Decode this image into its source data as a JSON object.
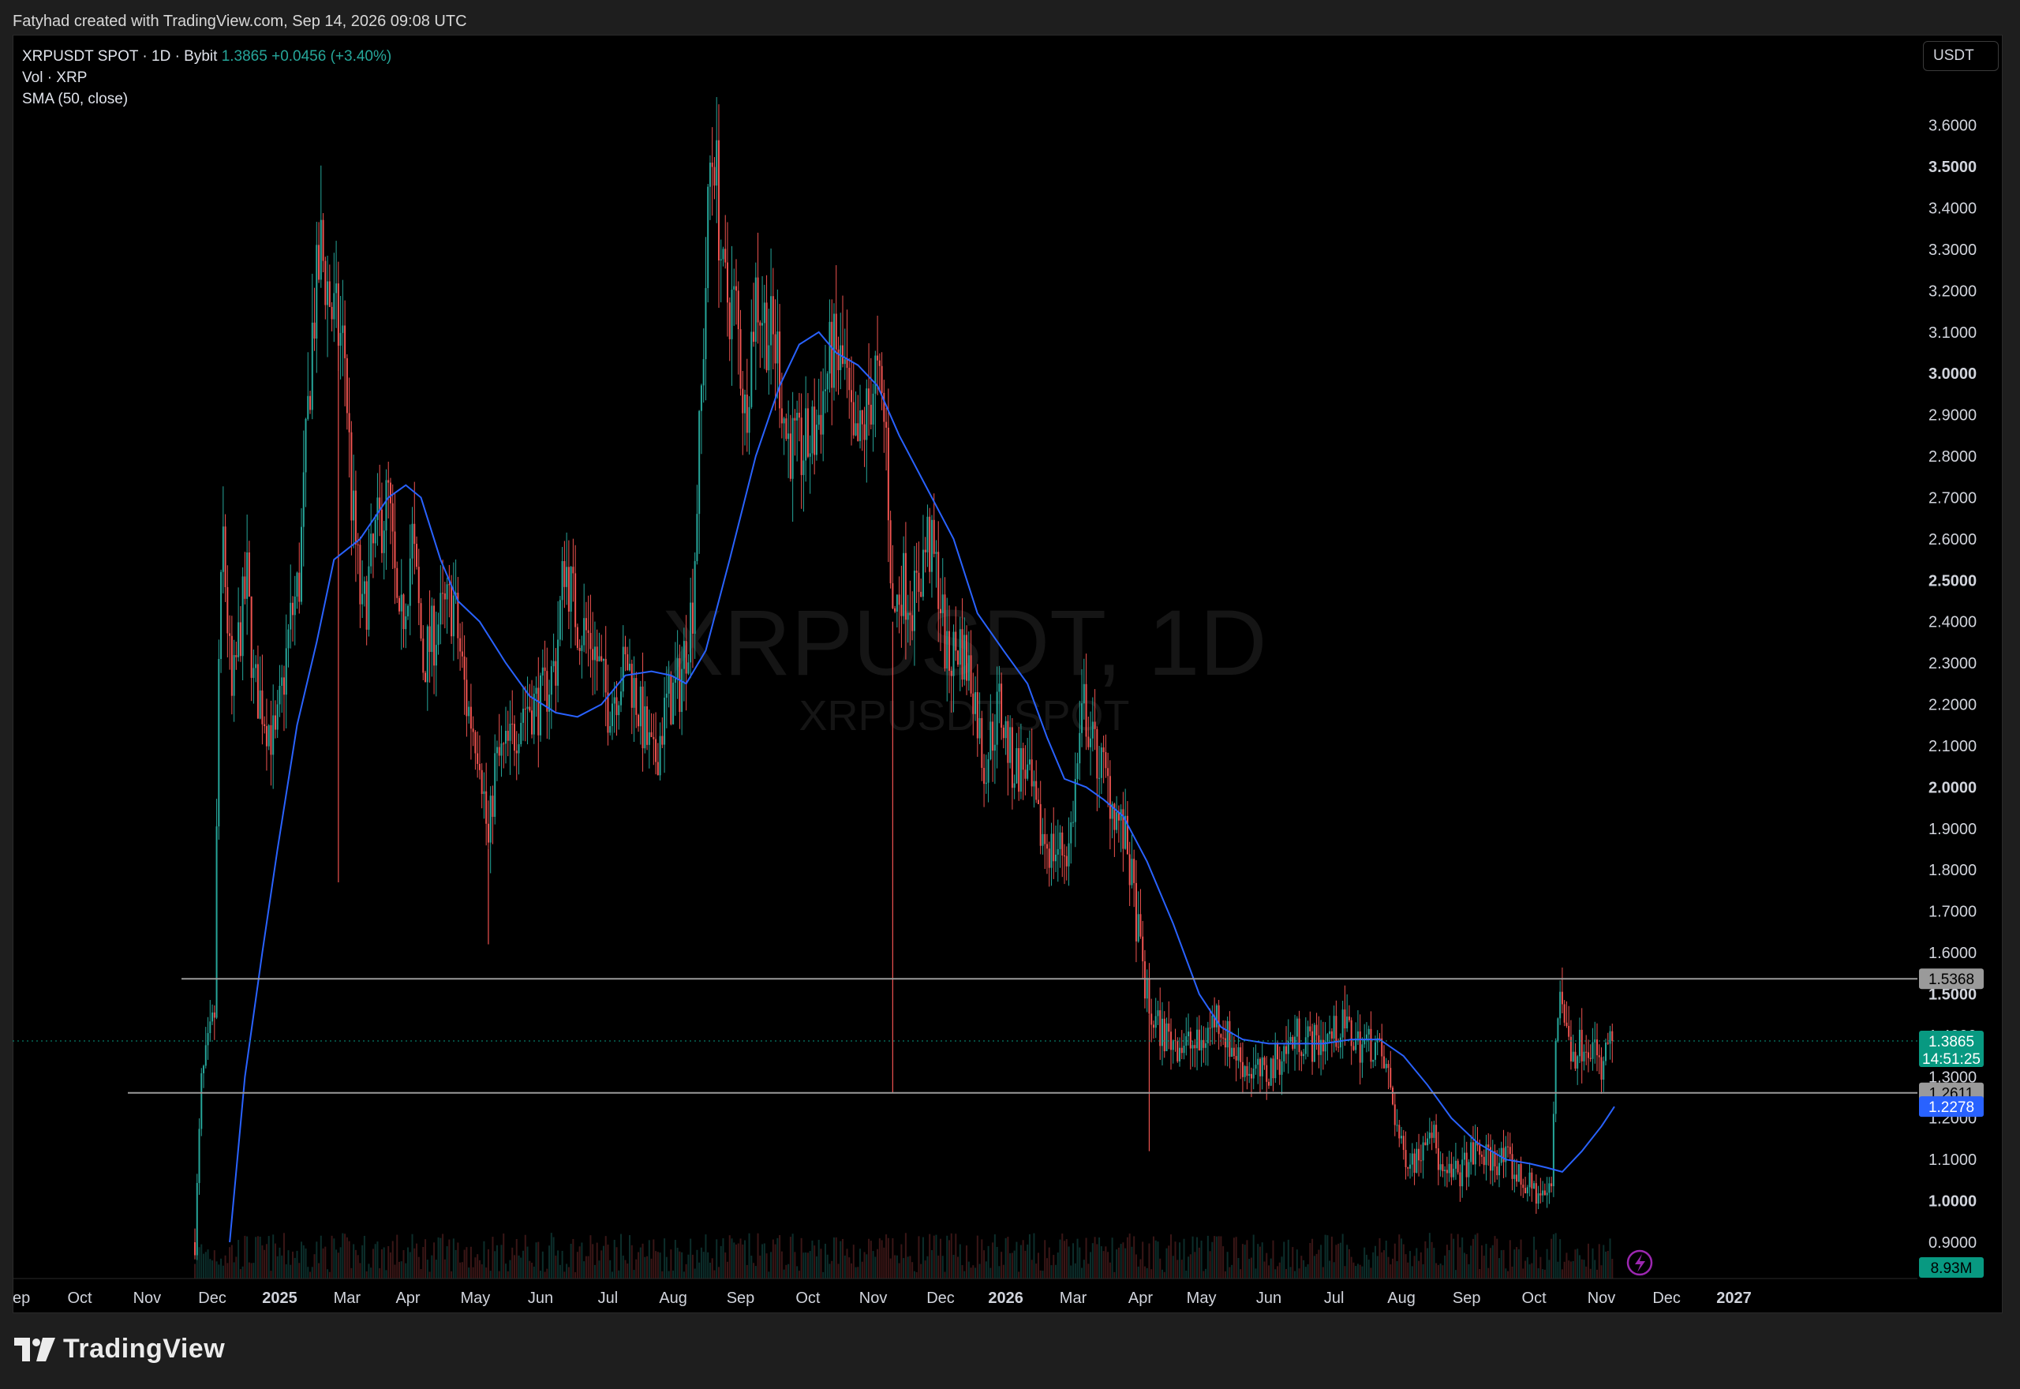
{
  "attribution": "Fatyhad created with TradingView.com, Sep 14, 2026 09:08 UTC",
  "legend": {
    "title": "XRPUSDT SPOT · 1D · Bybit",
    "last": "1.3865",
    "change": "+0.0456 (+3.40%)",
    "volume": "Vol · XRP",
    "indicator": "SMA (50, close)"
  },
  "watermark": {
    "main": "XRPUSDT, 1D",
    "sub": "XRPUSDT SPOT"
  },
  "unit": "USDT",
  "brand": {
    "name": "TradingView",
    "logo": "tradingview-logo-icon"
  },
  "volume_badge": "8.93M",
  "colors": {
    "up": "#26a69a",
    "down": "#ef5350",
    "sma": "#2962ff",
    "hline": "#9a9a9a",
    "price_tag": "#089981",
    "sma_tag": "#2962ff"
  },
  "chart_data": {
    "type": "candlestick",
    "y_axis": {
      "ticks": [
        "0.9000",
        "1.0000",
        "1.1000",
        "1.2000",
        "1.3000",
        "1.4000",
        "1.5000",
        "1.6000",
        "1.7000",
        "1.8000",
        "1.9000",
        "2.0000",
        "2.1000",
        "2.2000",
        "2.3000",
        "2.4000",
        "2.5000",
        "2.6000",
        "2.7000",
        "2.8000",
        "2.9000",
        "3.0000",
        "3.1000",
        "3.2000",
        "3.3000",
        "3.4000",
        "3.5000",
        "3.6000"
      ],
      "bold_ticks": [
        "1.0000",
        "1.5000",
        "2.0000",
        "2.5000",
        "3.0000",
        "3.5000"
      ],
      "ylim": [
        0.89,
        3.7
      ]
    },
    "x_axis": {
      "labels": [
        "ep",
        "Oct",
        "Nov",
        "Dec",
        "2025",
        "Mar",
        "Apr",
        "May",
        "Jun",
        "Jul",
        "Aug",
        "Sep",
        "Oct",
        "Nov",
        "Dec",
        "2026",
        "Mar",
        "Apr",
        "May",
        "Jun",
        "Jul",
        "Aug",
        "Sep",
        "Oct",
        "Nov",
        "Dec",
        "2027"
      ],
      "bold_labels": [
        "2025",
        "2026",
        "2027"
      ]
    },
    "horizontal_lines": [
      {
        "value": 1.5368,
        "label": "1.5368"
      },
      {
        "value": 1.2611,
        "label": "1.2611"
      }
    ],
    "last_price": {
      "value": 1.3865,
      "label": "1.3865",
      "countdown": "14:51:25"
    },
    "sma_last": {
      "value": 1.2278,
      "label": "1.2278"
    },
    "price_path": [
      [
        "2024-11-23",
        0.9
      ],
      [
        "2024-11-26",
        1.28
      ],
      [
        "2024-12-02",
        1.45
      ],
      [
        "2024-12-04",
        2.3
      ],
      [
        "2024-12-06",
        2.6
      ],
      [
        "2024-12-10",
        2.2
      ],
      [
        "2024-12-13",
        2.35
      ],
      [
        "2024-12-17",
        2.5
      ],
      [
        "2024-12-20",
        2.25
      ],
      [
        "2024-12-24",
        2.2
      ],
      [
        "2024-12-30",
        2.1
      ],
      [
        "2025-01-06",
        2.4
      ],
      [
        "2025-01-10",
        2.5
      ],
      [
        "2025-01-16",
        3.1
      ],
      [
        "2025-01-20",
        3.3
      ],
      [
        "2025-01-25",
        3.15
      ],
      [
        "2025-01-31",
        3.05
      ],
      [
        "2025-02-03",
        2.7
      ],
      [
        "2025-02-08",
        2.4
      ],
      [
        "2025-02-14",
        2.6
      ],
      [
        "2025-02-20",
        2.7
      ],
      [
        "2025-02-25",
        2.35
      ],
      [
        "2025-03-03",
        2.6
      ],
      [
        "2025-03-08",
        2.3
      ],
      [
        "2025-03-15",
        2.4
      ],
      [
        "2025-03-22",
        2.45
      ],
      [
        "2025-03-28",
        2.2
      ],
      [
        "2025-04-03",
        2.1
      ],
      [
        "2025-04-07",
        1.85
      ],
      [
        "2025-04-10",
        2.05
      ],
      [
        "2025-04-17",
        2.1
      ],
      [
        "2025-04-23",
        2.2
      ],
      [
        "2025-05-01",
        2.2
      ],
      [
        "2025-05-08",
        2.3
      ],
      [
        "2025-05-12",
        2.55
      ],
      [
        "2025-05-18",
        2.4
      ],
      [
        "2025-05-25",
        2.35
      ],
      [
        "2025-06-01",
        2.2
      ],
      [
        "2025-06-10",
        2.3
      ],
      [
        "2025-06-17",
        2.15
      ],
      [
        "2025-06-22",
        2.05
      ],
      [
        "2025-06-28",
        2.2
      ],
      [
        "2025-07-04",
        2.25
      ],
      [
        "2025-07-10",
        2.45
      ],
      [
        "2025-07-14",
        2.95
      ],
      [
        "2025-07-18",
        3.5
      ],
      [
        "2025-07-20",
        3.55
      ],
      [
        "2025-07-24",
        3.2
      ],
      [
        "2025-07-30",
        3.15
      ],
      [
        "2025-08-03",
        2.9
      ],
      [
        "2025-08-08",
        3.2
      ],
      [
        "2025-08-14",
        3.1
      ],
      [
        "2025-08-18",
        3.05
      ],
      [
        "2025-08-22",
        2.85
      ],
      [
        "2025-08-28",
        2.8
      ],
      [
        "2025-09-04",
        2.85
      ],
      [
        "2025-09-12",
        3.05
      ],
      [
        "2025-09-18",
        3.0
      ],
      [
        "2025-09-22",
        2.8
      ],
      [
        "2025-09-26",
        2.85
      ],
      [
        "2025-10-02",
        3.0
      ],
      [
        "2025-10-07",
        2.85
      ],
      [
        "2025-10-10",
        2.4
      ],
      [
        "2025-10-14",
        2.5
      ],
      [
        "2025-10-20",
        2.45
      ],
      [
        "2025-10-26",
        2.6
      ],
      [
        "2025-10-31",
        2.5
      ],
      [
        "2025-11-04",
        2.3
      ],
      [
        "2025-11-10",
        2.35
      ],
      [
        "2025-11-16",
        2.25
      ],
      [
        "2025-11-21",
        2.05
      ],
      [
        "2025-11-28",
        2.2
      ],
      [
        "2025-12-04",
        2.05
      ],
      [
        "2025-12-10",
        2.05
      ],
      [
        "2025-12-16",
        1.9
      ],
      [
        "2025-12-22",
        1.85
      ],
      [
        "2025-12-30",
        1.85
      ],
      [
        "2026-01-06",
        2.2
      ],
      [
        "2026-01-10",
        2.1
      ],
      [
        "2026-01-14",
        2.05
      ],
      [
        "2026-01-20",
        1.95
      ],
      [
        "2026-01-26",
        1.85
      ],
      [
        "2026-02-01",
        1.6
      ],
      [
        "2026-02-05",
        1.45
      ],
      [
        "2026-02-12",
        1.4
      ],
      [
        "2026-02-20",
        1.38
      ],
      [
        "2026-02-28",
        1.37
      ],
      [
        "2026-03-08",
        1.45
      ],
      [
        "2026-03-15",
        1.37
      ],
      [
        "2026-03-22",
        1.32
      ],
      [
        "2026-03-30",
        1.3
      ],
      [
        "2026-04-06",
        1.35
      ],
      [
        "2026-04-14",
        1.4
      ],
      [
        "2026-04-22",
        1.38
      ],
      [
        "2026-04-30",
        1.4
      ],
      [
        "2026-05-06",
        1.42
      ],
      [
        "2026-05-12",
        1.38
      ],
      [
        "2026-05-20",
        1.38
      ],
      [
        "2026-05-26",
        1.3
      ],
      [
        "2026-06-01",
        1.12
      ],
      [
        "2026-06-08",
        1.1
      ],
      [
        "2026-06-14",
        1.2
      ],
      [
        "2026-06-20",
        1.05
      ],
      [
        "2026-06-28",
        1.07
      ],
      [
        "2026-07-05",
        1.12
      ],
      [
        "2026-07-12",
        1.1
      ],
      [
        "2026-07-19",
        1.1
      ],
      [
        "2026-07-26",
        1.05
      ],
      [
        "2026-08-02",
        1.02
      ],
      [
        "2026-08-06",
        1.01
      ],
      [
        "2026-08-09",
        1.03
      ],
      [
        "2026-08-11",
        1.4
      ],
      [
        "2026-08-13",
        1.52
      ],
      [
        "2026-08-16",
        1.4
      ],
      [
        "2026-08-20",
        1.36
      ],
      [
        "2026-08-25",
        1.4
      ],
      [
        "2026-08-29",
        1.36
      ],
      [
        "2026-09-01",
        1.3
      ],
      [
        "2026-09-04",
        1.38
      ],
      [
        "2026-09-06",
        1.3865
      ]
    ],
    "sma_path": [
      [
        "2024-12-09",
        0.9
      ],
      [
        "2024-12-16",
        1.3
      ],
      [
        "2024-12-24",
        1.6
      ],
      [
        "2024-12-31",
        1.85
      ],
      [
        "2025-01-09",
        2.15
      ],
      [
        "2025-01-18",
        2.35
      ],
      [
        "2025-01-26",
        2.55
      ],
      [
        "2025-02-07",
        2.6
      ],
      [
        "2025-02-20",
        2.7
      ],
      [
        "2025-02-28",
        2.73
      ],
      [
        "2025-03-07",
        2.7
      ],
      [
        "2025-03-16",
        2.55
      ],
      [
        "2025-03-24",
        2.45
      ],
      [
        "2025-04-03",
        2.4
      ],
      [
        "2025-04-15",
        2.3
      ],
      [
        "2025-04-26",
        2.22
      ],
      [
        "2025-05-08",
        2.18
      ],
      [
        "2025-05-18",
        2.17
      ],
      [
        "2025-05-29",
        2.2
      ],
      [
        "2025-06-09",
        2.27
      ],
      [
        "2025-06-21",
        2.28
      ],
      [
        "2025-06-30",
        2.27
      ],
      [
        "2025-07-07",
        2.25
      ],
      [
        "2025-07-16",
        2.33
      ],
      [
        "2025-07-27",
        2.55
      ],
      [
        "2025-08-08",
        2.8
      ],
      [
        "2025-08-19",
        2.97
      ],
      [
        "2025-08-28",
        3.07
      ],
      [
        "2025-09-06",
        3.1
      ],
      [
        "2025-09-14",
        3.05
      ],
      [
        "2025-09-24",
        3.02
      ],
      [
        "2025-10-03",
        2.97
      ],
      [
        "2025-10-13",
        2.85
      ],
      [
        "2025-10-26",
        2.72
      ],
      [
        "2025-11-07",
        2.6
      ],
      [
        "2025-11-18",
        2.42
      ],
      [
        "2025-11-30",
        2.33
      ],
      [
        "2025-12-11",
        2.25
      ],
      [
        "2025-12-20",
        2.12
      ],
      [
        "2025-12-28",
        2.02
      ],
      [
        "2026-01-07",
        2.0
      ],
      [
        "2026-01-15",
        1.97
      ],
      [
        "2026-01-24",
        1.93
      ],
      [
        "2026-02-04",
        1.82
      ],
      [
        "2026-02-16",
        1.67
      ],
      [
        "2026-02-28",
        1.5
      ],
      [
        "2026-03-10",
        1.42
      ],
      [
        "2026-03-20",
        1.39
      ],
      [
        "2026-04-01",
        1.38
      ],
      [
        "2026-04-14",
        1.38
      ],
      [
        "2026-04-26",
        1.38
      ],
      [
        "2026-05-09",
        1.39
      ],
      [
        "2026-05-22",
        1.39
      ],
      [
        "2026-06-02",
        1.35
      ],
      [
        "2026-06-13",
        1.28
      ],
      [
        "2026-06-24",
        1.2
      ],
      [
        "2026-07-06",
        1.14
      ],
      [
        "2026-07-19",
        1.1
      ],
      [
        "2026-07-30",
        1.09
      ],
      [
        "2026-08-07",
        1.08
      ],
      [
        "2026-08-14",
        1.07
      ],
      [
        "2026-08-23",
        1.12
      ],
      [
        "2026-09-01",
        1.18
      ],
      [
        "2026-09-07",
        1.2278
      ]
    ]
  }
}
